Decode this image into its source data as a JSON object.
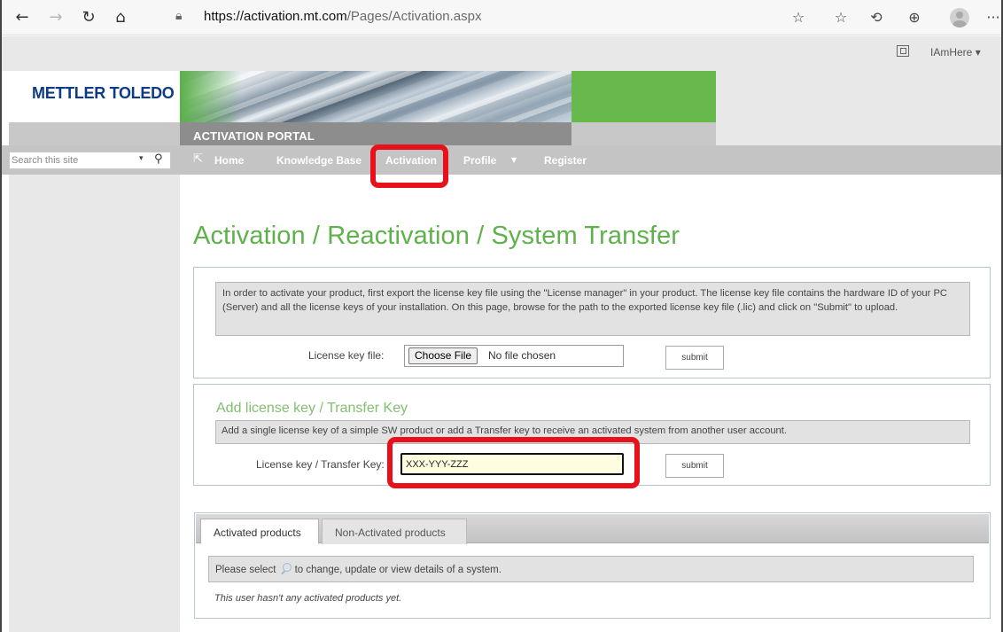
{
  "browser": {
    "url_host": "https://activation.mt.com",
    "url_path": "/Pages/Activation.aspx",
    "icons": [
      "back-icon",
      "forward-icon",
      "refresh-icon",
      "home-icon",
      "lock-icon",
      "favorites-add-icon",
      "favorites-icon",
      "history-icon",
      "collections-icon",
      "profile-icon",
      "more-icon"
    ],
    "more_label": "···"
  },
  "sp_strip": {
    "user_label": "IAmHere",
    "user_arrow": "▾"
  },
  "header": {
    "logo_text": "METTLER TOLEDO",
    "portal_title": "ACTIVATION PORTAL",
    "brand_green": "#68b94b",
    "brand_blue": "#0e3b86"
  },
  "search": {
    "placeholder": "Search this site",
    "dropdown_arrow": "▾",
    "search_icon": "⚲"
  },
  "nav": {
    "home_icon": "⇱",
    "items": [
      {
        "label": "Home"
      },
      {
        "label": "Knowledge Base"
      },
      {
        "label": "Activation"
      },
      {
        "label": "Profile"
      },
      {
        "label": "Register"
      }
    ],
    "profile_arrow": "▼",
    "highlight_color": "#e8101b"
  },
  "main": {
    "page_title": "Activation / Reactivation / System Transfer",
    "activation": {
      "info_text": "In order to activate your product, first export the license key file using the \"License manager\" in your product. The license key file contains the hardware ID of your PC (Server) and all the license keys of your installation. On this page, browse for the path to the exported license key file (.lic) and click on \"Submit\" to upload.",
      "file_label": "License key file:",
      "choose_file_label": "Choose File",
      "no_file_text": "No file chosen",
      "submit_label": "submit"
    },
    "add_key": {
      "title": "Add license key / Transfer Key",
      "info_text": "Add a single license key of a simple SW product or add a Transfer key to receive an activated system from another user account.",
      "field_label": "License key / Transfer Key:",
      "field_value": "XXX-YYY-ZZZ",
      "submit_label": "submit"
    },
    "products": {
      "tabs": [
        {
          "label": "Activated products",
          "active": true
        },
        {
          "label": "Non-Activated products",
          "active": false
        }
      ],
      "hint_before": "Please select",
      "hint_after": "to change, update or view details of a system.",
      "empty_text": "This user hasn't any activated products yet."
    }
  }
}
